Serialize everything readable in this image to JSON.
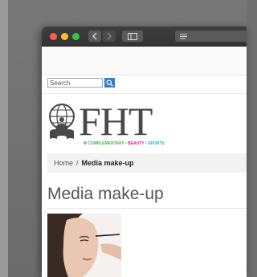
{
  "search": {
    "placeholder": "Search"
  },
  "logo": {
    "text": "FHT",
    "tagline_a": "COMPLEMENTARY",
    "tagline_b": "BEAUTY",
    "tagline_c": "SPORTS",
    "registered": "®"
  },
  "breadcrumb": {
    "home": "Home",
    "separator": "/",
    "current": "Media make-up"
  },
  "page": {
    "title": "Media make-up"
  },
  "colors": {
    "tagline_a": "#4cae4f",
    "tagline_b": "#e6197d",
    "tagline_c": "#27a6e0",
    "search_button": "#2f7fd0",
    "close_light": "#fb5c55",
    "minimize_light": "#fdbc2e",
    "zoom_light": "#32c645"
  },
  "icons": {
    "back": "chevron-left-icon",
    "forward": "chevron-right-icon",
    "sidebar": "sidebar-icon",
    "reader": "reader-icon",
    "search": "search-icon",
    "logo": "globe-figure-icon"
  }
}
